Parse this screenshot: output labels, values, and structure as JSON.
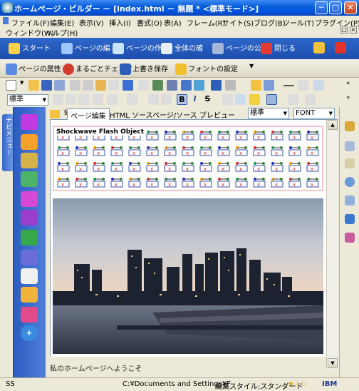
{
  "window": {
    "title": "ホームページ・ビルダー － [index.html － 無題 * <標準モード>]",
    "minimize": "─",
    "maximize": "□",
    "close": "✕"
  },
  "menu": {
    "row1": [
      "ファイル(F)",
      "編集(E)",
      "表示(V)",
      "挿入(I)",
      "書式(O)",
      "表(A)",
      "フレーム(R)",
      "サイト(S)",
      "ブログ(B)",
      "ツール(T)",
      "プラグイン(P)"
    ],
    "row2": [
      "ウィンドウ(W)",
      "ヘルプ(H)"
    ]
  },
  "nav1": {
    "items": [
      "スタート",
      "ページの編",
      "ページの作",
      "全体の確",
      "ページの公",
      "閉じる"
    ]
  },
  "nav2": {
    "items": [
      "ページの属性",
      "まるごとチェック",
      "上書き保存",
      "フォントの設定"
    ]
  },
  "format": {
    "paragraph_style": "標準",
    "bold": "B",
    "italic": "I",
    "strike": "S"
  },
  "left": {
    "nav_tab": "ナビメニュー"
  },
  "tabs": {
    "items": [
      "ページ編集",
      "HTML ソース",
      "ページ/ソース",
      "プレビュー"
    ],
    "style_select": "標準",
    "font_select": "FONT"
  },
  "editor": {
    "flash_label": "Shockwave Flash Object",
    "body_text": "私のホームページへようこそ"
  },
  "statusbar": {
    "mode": "SS",
    "path": "C:¥Documents and Settings¥F",
    "style": "編集スタイル:スタンダード",
    "brand": "IBM"
  },
  "colors": {
    "titlebar": "#0054e3",
    "nav_toolbar": "#2457bd",
    "left_panel": "#3a6ccc",
    "flash_border": "#f7c3c9"
  }
}
